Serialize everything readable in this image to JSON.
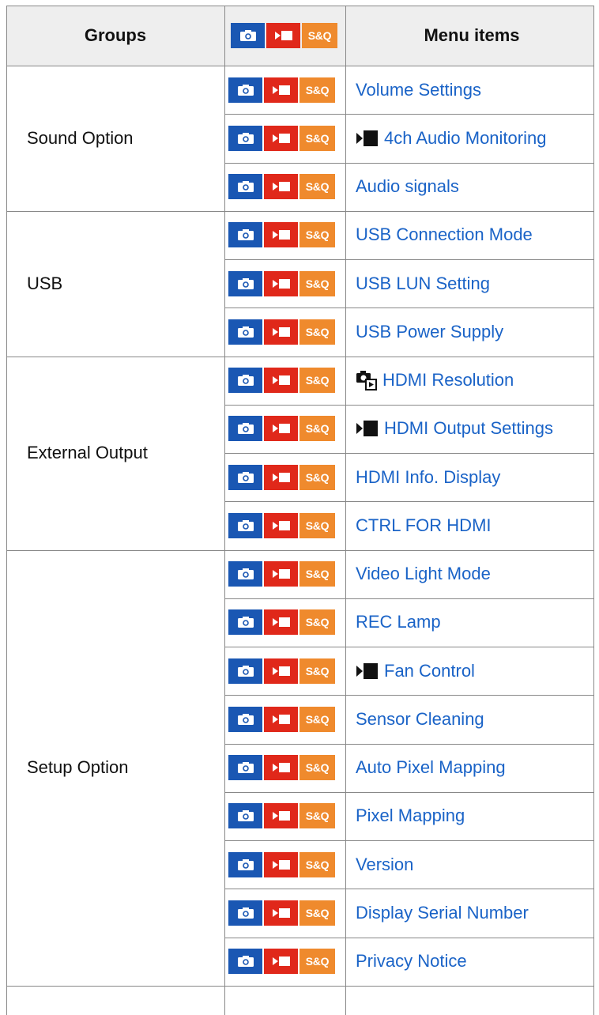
{
  "header": {
    "groups": "Groups",
    "mode_sq": "S&Q",
    "menu_items": "Menu items"
  },
  "icon_names": {
    "photo": "camera-icon",
    "movie": "movie-icon",
    "sq": "sq-icon"
  },
  "colors": {
    "photo": "#1a57b3",
    "movie": "#e0281a",
    "sq": "#ef8a2d",
    "link": "#1a63c7"
  },
  "groups": [
    {
      "label": "Sound Option",
      "items": [
        {
          "label": "Volume Settings"
        },
        {
          "label": "4ch Audio Monitoring",
          "prefix": "movie-only-icon"
        },
        {
          "label": "Audio signals"
        }
      ]
    },
    {
      "label": "USB",
      "items": [
        {
          "label": "USB Connection Mode"
        },
        {
          "label": "USB LUN Setting"
        },
        {
          "label": "USB Power Supply"
        }
      ]
    },
    {
      "label": "External Output",
      "items": [
        {
          "label": "HDMI Resolution",
          "prefix": "photo-playback-icon"
        },
        {
          "label": "HDMI Output Settings",
          "prefix": "movie-only-icon"
        },
        {
          "label": "HDMI Info. Display"
        },
        {
          "label": "CTRL FOR HDMI"
        }
      ]
    },
    {
      "label": "Setup Option",
      "items": [
        {
          "label": "Video Light Mode"
        },
        {
          "label": "REC Lamp"
        },
        {
          "label": "Fan Control",
          "prefix": "movie-only-icon"
        },
        {
          "label": "Sensor Cleaning"
        },
        {
          "label": "Auto Pixel Mapping"
        },
        {
          "label": "Pixel Mapping"
        },
        {
          "label": "Version"
        },
        {
          "label": "Display Serial Number"
        },
        {
          "label": "Privacy Notice"
        }
      ]
    }
  ],
  "mode_sq_label": "S&Q"
}
